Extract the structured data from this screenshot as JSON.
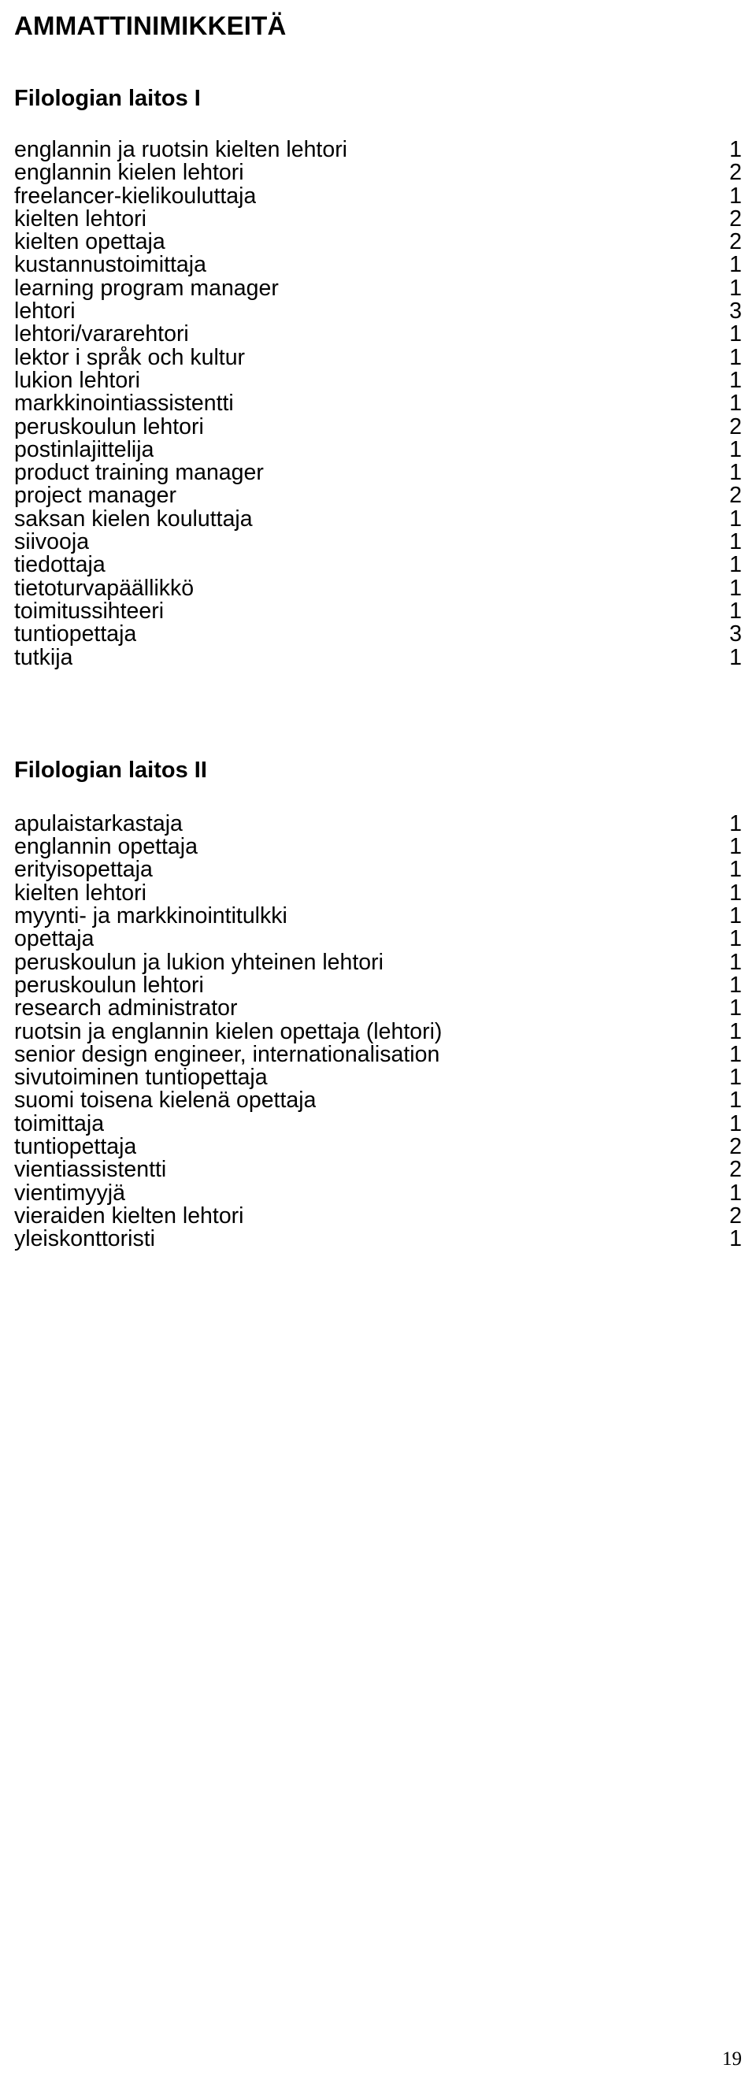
{
  "document": {
    "title": "AMMATTINIMIKKEITÄ",
    "page_number": "19"
  },
  "sections": [
    {
      "heading": "Filologian laitos I",
      "entries": [
        {
          "label": "englannin ja ruotsin kielten lehtori",
          "count": "1"
        },
        {
          "label": "englannin kielen lehtori",
          "count": "2"
        },
        {
          "label": "freelancer-kielikouluttaja",
          "count": "1"
        },
        {
          "label": "kielten lehtori",
          "count": "2"
        },
        {
          "label": "kielten opettaja",
          "count": "2"
        },
        {
          "label": "kustannustoimittaja",
          "count": "1"
        },
        {
          "label": "learning program manager",
          "count": "1"
        },
        {
          "label": "lehtori",
          "count": "3"
        },
        {
          "label": "lehtori/vararehtori",
          "count": "1"
        },
        {
          "label": "lektor i språk och kultur",
          "count": "1"
        },
        {
          "label": "lukion lehtori",
          "count": "1"
        },
        {
          "label": "markkinointiassistentti",
          "count": "1"
        },
        {
          "label": "peruskoulun lehtori",
          "count": "2"
        },
        {
          "label": "postinlajittelija",
          "count": "1"
        },
        {
          "label": "product training manager",
          "count": "1"
        },
        {
          "label": "project manager",
          "count": "2"
        },
        {
          "label": "saksan kielen kouluttaja",
          "count": "1"
        },
        {
          "label": "siivooja",
          "count": "1"
        },
        {
          "label": "tiedottaja",
          "count": "1"
        },
        {
          "label": "tietoturvapäällikkö",
          "count": "1"
        },
        {
          "label": "toimitussihteeri",
          "count": "1"
        },
        {
          "label": "tuntiopettaja",
          "count": "3"
        },
        {
          "label": "tutkija",
          "count": "1"
        }
      ]
    },
    {
      "heading": "Filologian laitos II",
      "entries": [
        {
          "label": "apulaistarkastaja",
          "count": "1"
        },
        {
          "label": "englannin opettaja",
          "count": "1"
        },
        {
          "label": "erityisopettaja",
          "count": "1"
        },
        {
          "label": "kielten lehtori",
          "count": "1"
        },
        {
          "label": "myynti- ja markkinointitulkki",
          "count": "1"
        },
        {
          "label": "opettaja",
          "count": "1"
        },
        {
          "label": "peruskoulun ja lukion yhteinen lehtori",
          "count": "1"
        },
        {
          "label": "peruskoulun lehtori",
          "count": "1"
        },
        {
          "label": "research administrator",
          "count": "1"
        },
        {
          "label": "ruotsin ja englannin kielen opettaja (lehtori)",
          "count": "1"
        },
        {
          "label": "senior design engineer, internationalisation",
          "count": "1"
        },
        {
          "label": "sivutoiminen tuntiopettaja",
          "count": "1"
        },
        {
          "label": "suomi toisena kielenä opettaja",
          "count": "1"
        },
        {
          "label": "toimittaja",
          "count": "1"
        },
        {
          "label": "tuntiopettaja",
          "count": "2"
        },
        {
          "label": "vientiassistentti",
          "count": "2"
        },
        {
          "label": "vientimyyjä",
          "count": "1"
        },
        {
          "label": "vieraiden kielten lehtori",
          "count": "2"
        },
        {
          "label": "yleiskonttoristi",
          "count": "1"
        }
      ]
    }
  ]
}
